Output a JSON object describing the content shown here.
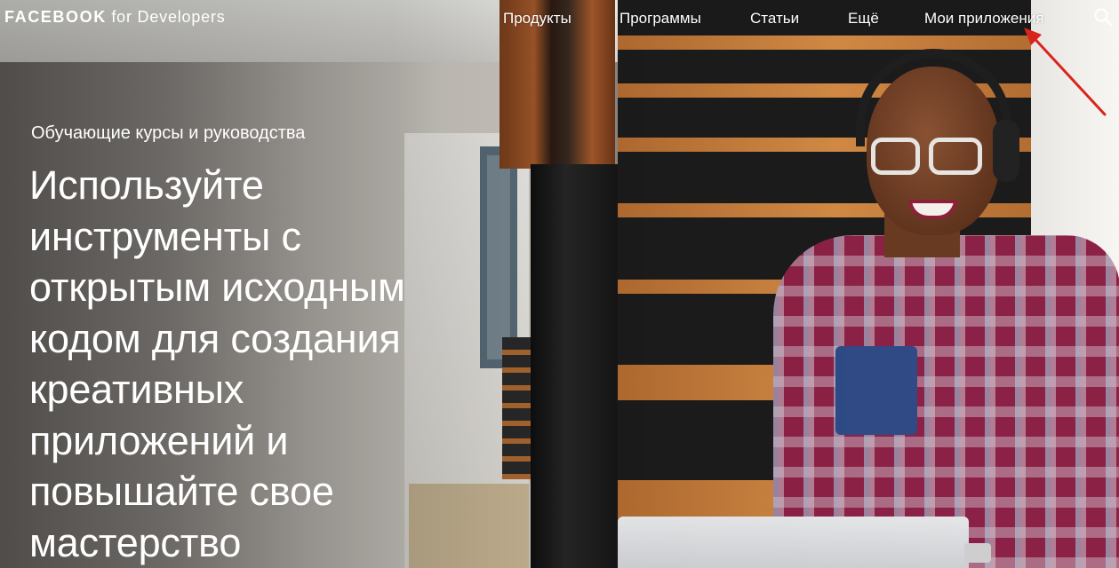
{
  "header": {
    "logo_brand": "FACEBOOK",
    "logo_rest": "for Developers",
    "nav": [
      {
        "label": "Продукты"
      },
      {
        "label": "Программы"
      },
      {
        "label": "Статьи"
      },
      {
        "label": "Ещё"
      },
      {
        "label": "Мои приложения"
      }
    ],
    "search_icon": "search-icon"
  },
  "hero": {
    "eyebrow": "Обучающие курсы и руководства",
    "headline_lines": [
      "Используйте",
      "инструменты с",
      "открытым исходным",
      "кодом для создания",
      "креативных",
      "приложений и",
      "повышайте свое",
      "мастерство"
    ]
  },
  "annotation": {
    "arrow_color": "#d9241c",
    "arrow_target": "Мои приложения"
  }
}
